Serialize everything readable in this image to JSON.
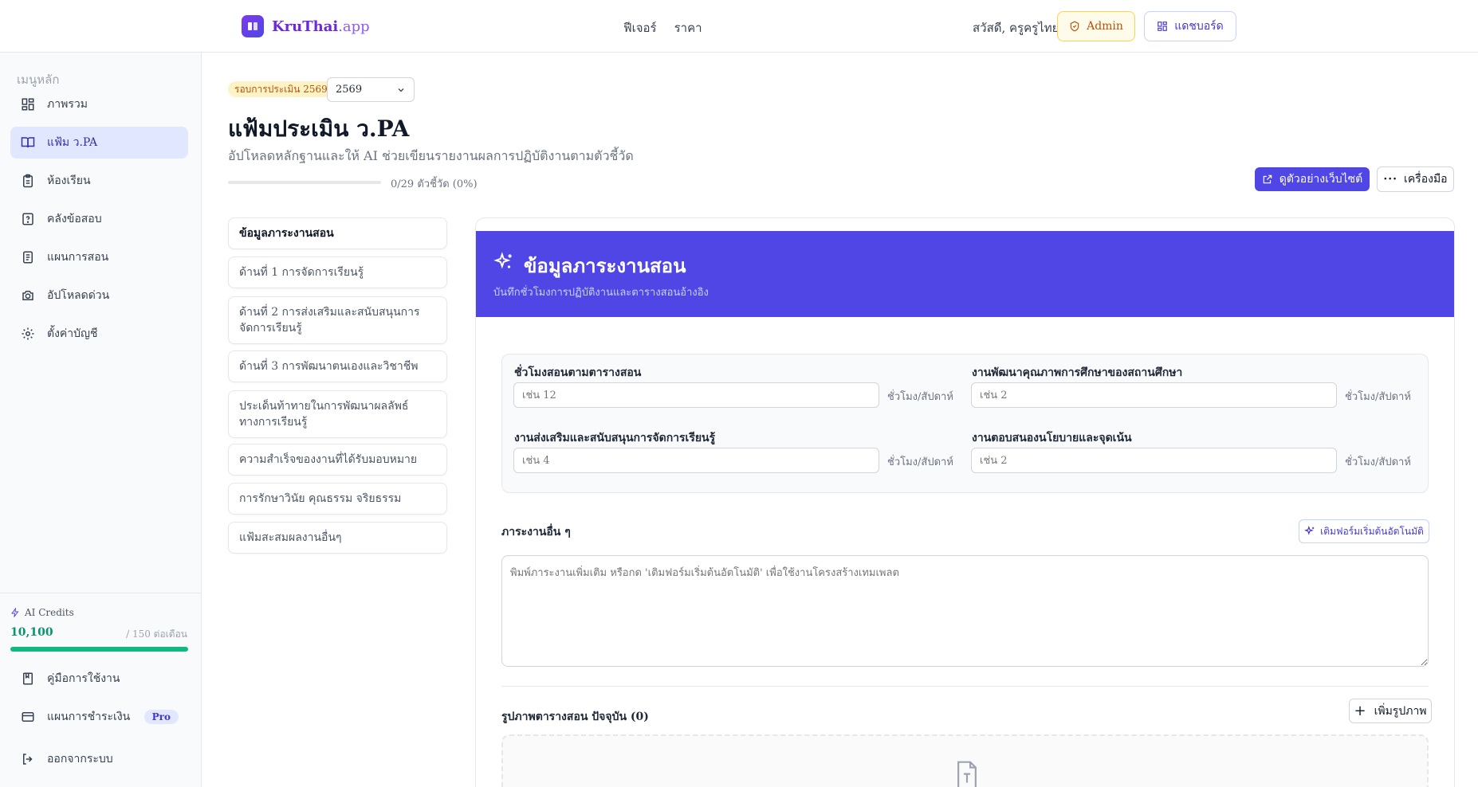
{
  "brand": {
    "name": "KruThai",
    "tld": ".app"
  },
  "topnav": {
    "items": [
      "ฟีเจอร์",
      "ราคา"
    ]
  },
  "header": {
    "greeting": "สวัสดี, ครูครูไทย",
    "admin_label": "Admin",
    "dashboard_label": "แดชบอร์ด"
  },
  "sidebar": {
    "heading": "เมนูหลัก",
    "items": [
      {
        "label": "ภาพรวม",
        "icon": "dashboard-icon"
      },
      {
        "label": "แฟ้ม ว.PA",
        "icon": "book-icon",
        "active": true
      },
      {
        "label": "ห้องเรียน",
        "icon": "clipboard-icon"
      },
      {
        "label": "คลังข้อสอบ",
        "icon": "question-icon"
      },
      {
        "label": "แผนการสอน",
        "icon": "document-icon"
      },
      {
        "label": "อัปโหลดด่วน",
        "icon": "camera-icon"
      },
      {
        "label": "ตั้งค่าบัญชี",
        "icon": "gear-icon"
      }
    ],
    "credits": {
      "title": "AI Credits",
      "value": "10,100",
      "per_month": "/ 150 ต่อเดือน",
      "level": 1.0
    },
    "bottom": [
      {
        "label": "คู่มือการใช้งาน",
        "icon": "manual-icon"
      },
      {
        "label": "แผนการชำระเงิน",
        "icon": "card-icon",
        "badge": "Pro"
      },
      {
        "label": "ออกจากระบบ",
        "icon": "logout-icon"
      }
    ]
  },
  "main": {
    "round_chip": "รอบการประเมิน 2569",
    "year_value": "2569",
    "title": "แฟ้มประเมิน ว.PA",
    "subtitle": "อัปโหลดหลักฐานและให้ AI ช่วยเขียนรายงานผลการปฏิบัติงานตามตัวชี้วัด",
    "progress_text": "0/29 ตัวชี้วัด (0%)",
    "progress": 0,
    "preview_label": "ดูตัวอย่างเว็บไซต์",
    "tools_label": "เครื่องมือ",
    "sections": [
      "ข้อมูลภาระงานสอน",
      "ด้านที่ 1 การจัดการเรียนรู้",
      "ด้านที่ 2 การส่งเสริมและสนับสนุนการจัดการเรียนรู้",
      "ด้านที่ 3 การพัฒนาตนเองและวิชาชีพ",
      "ประเด็นท้าทายในการพัฒนาผลลัพธ์ทางการเรียนรู้",
      "ความสำเร็จของงานที่ได้รับมอบหมาย",
      "การรักษาวินัย คุณธรรม จริยธรรม",
      "แฟ้มสะสมผลงานอื่นๆ"
    ]
  },
  "card": {
    "title": "ข้อมูลภาระงานสอน",
    "subtitle": "บันทึกชั่วโมงการปฏิบัติงานและตารางสอนอ้างอิง",
    "fields": [
      {
        "label": "ชั่วโมงสอนตามตารางสอน",
        "placeholder": "เช่น 12",
        "unit": "ชั่วโมง/สัปดาห์"
      },
      {
        "label": "งานพัฒนาคุณภาพการศึกษาของสถานศึกษา",
        "placeholder": "เช่น 2",
        "unit": "ชั่วโมง/สัปดาห์"
      },
      {
        "label": "งานส่งเสริมและสนับสนุนการจัดการเรียนรู้",
        "placeholder": "เช่น 4",
        "unit": "ชั่วโมง/สัปดาห์"
      },
      {
        "label": "งานตอบสนองนโยบายและจุดเน้น",
        "placeholder": "เช่น 2",
        "unit": "ชั่วโมง/สัปดาห์"
      }
    ],
    "other_label": "ภาระงานอื่น ๆ",
    "autofill_label": "เติมฟอร์มเริ่มต้นอัตโนมัติ",
    "textarea_placeholder": "พิมพ์ภาระงานเพิ่มเติม หรือกด 'เติมฟอร์มเริ่มต้นอัตโนมัติ' เพื่อใช้งานโครงสร้างเทมเพลต",
    "images_label": "รูปภาพตารางสอน ปัจจุบัน (0)",
    "add_image_label": "เพิ่มรูปภาพ"
  },
  "colors": {
    "accent": "#4f46e5",
    "brand": "#6d28d9",
    "credits": "#10b981",
    "admin": "#b45309"
  }
}
